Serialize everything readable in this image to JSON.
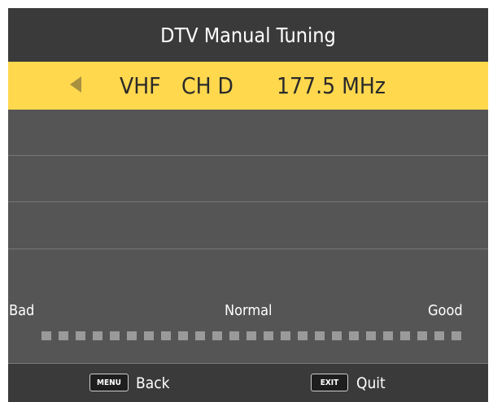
{
  "menu": {
    "title": "DTV Manual Tuning"
  },
  "channel": {
    "band": "VHF",
    "channel": "CH D",
    "frequency": "177.5 MHz"
  },
  "signal": {
    "low_label": "Bad",
    "mid_label": "Normal",
    "high_label": "Good",
    "segments_total": 25,
    "segments_lit": 0
  },
  "footer": {
    "menu_key": "MENU",
    "menu_action": "Back",
    "exit_key": "EXIT",
    "exit_action": "Quit"
  },
  "colors": {
    "background": "#555555",
    "header": "#3a3a3a",
    "highlight": "#ffd84e",
    "segment": "#9a9a9a"
  }
}
